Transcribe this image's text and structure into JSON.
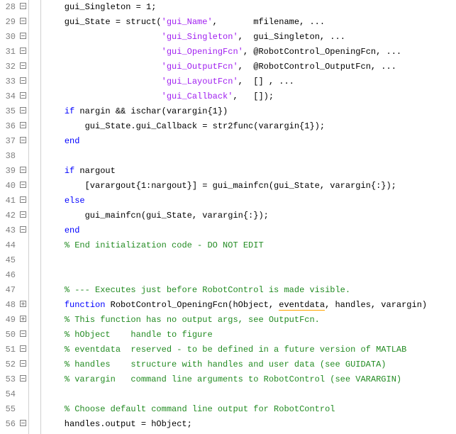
{
  "lines": [
    {
      "n": 28,
      "fold": "-",
      "tokens": [
        {
          "c": "id",
          "t": "    gui_Singleton = 1;"
        }
      ]
    },
    {
      "n": 29,
      "fold": "-",
      "tokens": [
        {
          "c": "id",
          "t": "    gui_State = struct("
        },
        {
          "c": "str",
          "t": "'gui_Name'"
        },
        {
          "c": "id",
          "t": ",       mfilename, ..."
        }
      ]
    },
    {
      "n": 30,
      "fold": "-",
      "tokens": [
        {
          "c": "id",
          "t": "                       "
        },
        {
          "c": "str",
          "t": "'gui_Singleton'"
        },
        {
          "c": "id",
          "t": ",  gui_Singleton, ..."
        }
      ]
    },
    {
      "n": 31,
      "fold": "-",
      "tokens": [
        {
          "c": "id",
          "t": "                       "
        },
        {
          "c": "str",
          "t": "'gui_OpeningFcn'"
        },
        {
          "c": "id",
          "t": ", @RobotControl_OpeningFcn, ..."
        }
      ]
    },
    {
      "n": 32,
      "fold": "-",
      "tokens": [
        {
          "c": "id",
          "t": "                       "
        },
        {
          "c": "str",
          "t": "'gui_OutputFcn'"
        },
        {
          "c": "id",
          "t": ",  @RobotControl_OutputFcn, ..."
        }
      ]
    },
    {
      "n": 33,
      "fold": "-",
      "tokens": [
        {
          "c": "id",
          "t": "                       "
        },
        {
          "c": "str",
          "t": "'gui_LayoutFcn'"
        },
        {
          "c": "id",
          "t": ",  [] , ..."
        }
      ]
    },
    {
      "n": 34,
      "fold": "-",
      "tokens": [
        {
          "c": "id",
          "t": "                       "
        },
        {
          "c": "str",
          "t": "'gui_Callback'"
        },
        {
          "c": "id",
          "t": ",   []);"
        }
      ]
    },
    {
      "n": 35,
      "fold": "-",
      "tokens": [
        {
          "c": "id",
          "t": "    "
        },
        {
          "c": "kw",
          "t": "if"
        },
        {
          "c": "id",
          "t": " nargin && ischar(varargin{1})"
        }
      ]
    },
    {
      "n": 36,
      "fold": "-",
      "tokens": [
        {
          "c": "id",
          "t": "        gui_State.gui_Callback = str2func(varargin{1});"
        }
      ]
    },
    {
      "n": 37,
      "fold": "-",
      "tokens": [
        {
          "c": "id",
          "t": "    "
        },
        {
          "c": "kw",
          "t": "end"
        }
      ]
    },
    {
      "n": 38,
      "fold": "",
      "tokens": [
        {
          "c": "id",
          "t": " "
        }
      ]
    },
    {
      "n": 39,
      "fold": "-",
      "tokens": [
        {
          "c": "id",
          "t": "    "
        },
        {
          "c": "kw",
          "t": "if"
        },
        {
          "c": "id",
          "t": " nargout"
        }
      ]
    },
    {
      "n": 40,
      "fold": "-",
      "tokens": [
        {
          "c": "id",
          "t": "        [varargout{1:nargout}] = gui_mainfcn(gui_State, varargin{:});"
        }
      ]
    },
    {
      "n": 41,
      "fold": "-",
      "tokens": [
        {
          "c": "id",
          "t": "    "
        },
        {
          "c": "kw",
          "t": "else"
        }
      ]
    },
    {
      "n": 42,
      "fold": "-",
      "tokens": [
        {
          "c": "id",
          "t": "        gui_mainfcn(gui_State, varargin{:});"
        }
      ]
    },
    {
      "n": 43,
      "fold": "-",
      "tokens": [
        {
          "c": "id",
          "t": "    "
        },
        {
          "c": "kw",
          "t": "end"
        }
      ]
    },
    {
      "n": 44,
      "fold": "",
      "tokens": [
        {
          "c": "id",
          "t": "    "
        },
        {
          "c": "cmt",
          "t": "% End initialization code - DO NOT EDIT"
        }
      ]
    },
    {
      "n": 45,
      "fold": "",
      "tokens": [
        {
          "c": "id",
          "t": " "
        }
      ]
    },
    {
      "n": 46,
      "fold": "",
      "tokens": [
        {
          "c": "id",
          "t": " "
        }
      ]
    },
    {
      "n": 47,
      "fold": "",
      "tokens": [
        {
          "c": "id",
          "t": "    "
        },
        {
          "c": "cmt",
          "t": "% --- Executes just before RobotControl is made visible."
        }
      ]
    },
    {
      "n": 48,
      "fold": "+",
      "tokens": [
        {
          "c": "id",
          "t": "    "
        },
        {
          "c": "kw",
          "t": "function"
        },
        {
          "c": "id",
          "t": " RobotControl_OpeningFcn(hObject, "
        },
        {
          "c": "id warn",
          "t": "eventdata"
        },
        {
          "c": "id",
          "t": ", handles, varargin)"
        }
      ]
    },
    {
      "n": 49,
      "fold": "+",
      "tokens": [
        {
          "c": "id",
          "t": "    "
        },
        {
          "c": "cmt",
          "t": "% This function has no output args, see OutputFcn."
        }
      ]
    },
    {
      "n": 50,
      "fold": "-",
      "tokens": [
        {
          "c": "id",
          "t": "    "
        },
        {
          "c": "cmt",
          "t": "% hObject    handle to figure"
        }
      ]
    },
    {
      "n": 51,
      "fold": "-",
      "tokens": [
        {
          "c": "id",
          "t": "    "
        },
        {
          "c": "cmt",
          "t": "% eventdata  reserved - to be defined in a future version of MATLAB"
        }
      ]
    },
    {
      "n": 52,
      "fold": "-",
      "tokens": [
        {
          "c": "id",
          "t": "    "
        },
        {
          "c": "cmt",
          "t": "% handles    structure with handles and user data (see GUIDATA)"
        }
      ]
    },
    {
      "n": 53,
      "fold": "-",
      "tokens": [
        {
          "c": "id",
          "t": "    "
        },
        {
          "c": "cmt",
          "t": "% varargin   command line arguments to RobotControl (see VARARGIN)"
        }
      ]
    },
    {
      "n": 54,
      "fold": "",
      "tokens": [
        {
          "c": "id",
          "t": " "
        }
      ]
    },
    {
      "n": 55,
      "fold": "",
      "tokens": [
        {
          "c": "id",
          "t": "    "
        },
        {
          "c": "cmt",
          "t": "% Choose default command line output for RobotControl"
        }
      ]
    },
    {
      "n": 56,
      "fold": "-",
      "tokens": [
        {
          "c": "id",
          "t": "    handles.output = hObject;"
        }
      ]
    }
  ]
}
